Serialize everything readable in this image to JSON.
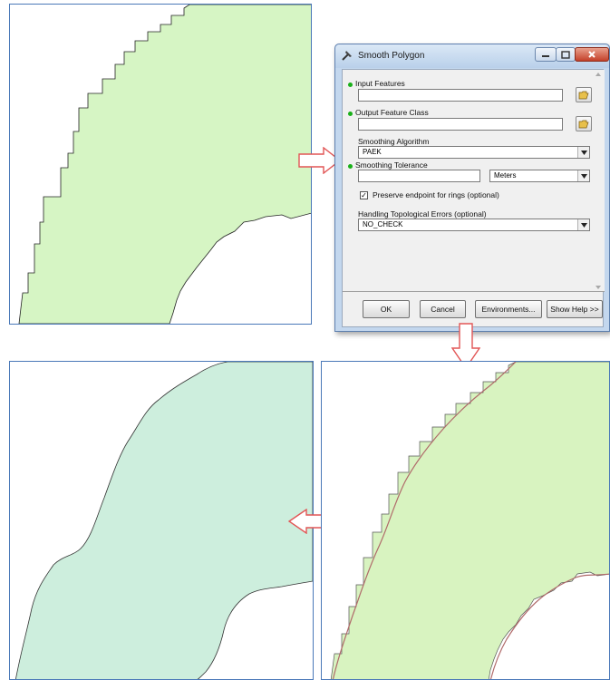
{
  "dialog": {
    "title": "Smooth Polygon",
    "fields": {
      "input_features": {
        "label": "Input Features",
        "value": ""
      },
      "output_feature_class": {
        "label": "Output Feature Class",
        "value": ""
      },
      "smoothing_algorithm": {
        "label": "Smoothing Algorithm",
        "value": "PAEK"
      },
      "smoothing_tolerance": {
        "label": "Smoothing Tolerance",
        "value": "",
        "unit": "Meters"
      },
      "preserve_endpoint": {
        "label": "Preserve endpoint for rings (optional)",
        "checked": true,
        "mark": "✓"
      },
      "topological_errors": {
        "label": "Handling Topological Errors (optional)",
        "value": "NO_CHECK"
      }
    },
    "buttons": {
      "ok": "OK",
      "cancel": "Cancel",
      "environments": "Environments...",
      "show_help": "Show Help >>"
    },
    "window_controls": {
      "minimize": "–",
      "maximize": "□",
      "close": "x"
    }
  },
  "panels": {
    "original": {
      "fill": "#d6f5c4",
      "stroke": "#222222"
    },
    "smoothed": {
      "fill": "#cdeedd",
      "stroke": "#333333"
    },
    "overlay": {
      "fill": "#d8f3c0",
      "stroke_new": "#b06a6a"
    }
  },
  "arrows": {
    "stroke": "#e25555",
    "fill": "#ffffff"
  },
  "colors": {
    "required_dot": "#19b019",
    "panel_border": "#4a78b8"
  }
}
